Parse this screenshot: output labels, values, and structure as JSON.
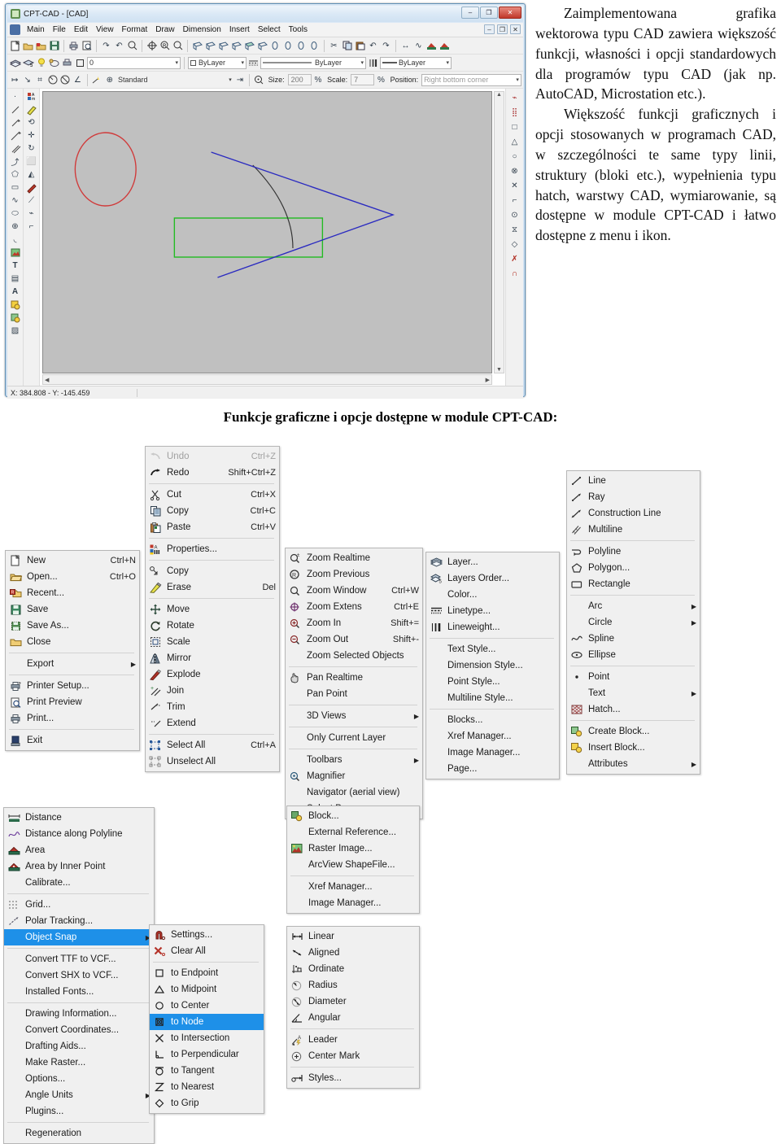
{
  "window": {
    "title": "CPT-CAD - [CAD]",
    "win_buttons": [
      "–",
      "❐",
      "✕"
    ],
    "mdi_buttons": [
      "–",
      "❐",
      "✕"
    ],
    "menus": [
      "Main",
      "File",
      "Edit",
      "View",
      "Format",
      "Draw",
      "Dimension",
      "Insert",
      "Select",
      "Tools"
    ],
    "layer_value": "0",
    "color_value": "ByLayer",
    "linetype_value": "ByLayer",
    "lineweight_value": "ByLayer",
    "text_style_value": "Standard",
    "size_label": "Size:",
    "size_value": "200",
    "scale_label": "Scale:",
    "scale_value": "7",
    "position_label": "Position:",
    "position_value": "Right bottom corner",
    "status_coords": "X: 384.808  -  Y: -145.459"
  },
  "article": {
    "p1": "Zaimplementowana grafika wektorowa typu CAD zawiera większość funkcji, własności i opcji standardowych dla programów typu CAD (jak np. AutoCAD, Microstation etc.).",
    "p2": "Większość funkcji graficznych i opcji stosowanych w programach CAD, w szczególności  te same typy linii, struktury (bloki etc.), wypełnienia typu hatch, warstwy CAD, wymiarowanie, są dostępne w module CPT-CAD i łatwo dostępne z menu i ikon."
  },
  "caption": "Funkcje graficzne i opcje dostępne w module CPT-CAD:",
  "menus": {
    "file": {
      "name": "File",
      "items": [
        {
          "icon": "new-file-icon",
          "label": "New",
          "accel": "Ctrl+N"
        },
        {
          "icon": "open-folder-icon",
          "label": "Open...",
          "accel": "Ctrl+O"
        },
        {
          "icon": "recent-folder-icon",
          "label": "Recent...",
          "accel": ""
        },
        {
          "icon": "save-disk-icon",
          "label": "Save",
          "accel": ""
        },
        {
          "icon": "save-as-disk-icon",
          "label": "Save As...",
          "accel": ""
        },
        {
          "icon": "close-folder-icon",
          "label": "Close",
          "accel": ""
        },
        {
          "sep": true
        },
        {
          "icon": "",
          "label": "Export",
          "accel": "",
          "arrow": true
        },
        {
          "sep": true
        },
        {
          "icon": "printer-setup-icon",
          "label": "Printer Setup...",
          "accel": ""
        },
        {
          "icon": "print-preview-icon",
          "label": "Print Preview",
          "accel": ""
        },
        {
          "icon": "printer-icon",
          "label": "Print...",
          "accel": ""
        },
        {
          "sep": true
        },
        {
          "icon": "exit-icon",
          "label": "Exit",
          "accel": ""
        }
      ]
    },
    "edit": {
      "name": "Edit",
      "items": [
        {
          "icon": "undo-icon",
          "label": "Undo",
          "accel": "Ctrl+Z",
          "disabled": true
        },
        {
          "icon": "redo-icon",
          "label": "Redo",
          "accel": "Shift+Ctrl+Z"
        },
        {
          "sep": true
        },
        {
          "icon": "scissors-icon",
          "label": "Cut",
          "accel": "Ctrl+X"
        },
        {
          "icon": "copy-icon",
          "label": "Copy",
          "accel": "Ctrl+C"
        },
        {
          "icon": "paste-icon",
          "label": "Paste",
          "accel": "Ctrl+V"
        },
        {
          "sep": true
        },
        {
          "icon": "properties-icon",
          "label": "Properties...",
          "accel": ""
        },
        {
          "sep": true
        },
        {
          "icon": "copy-object-icon",
          "label": "Copy",
          "accel": ""
        },
        {
          "icon": "erase-icon",
          "label": "Erase",
          "accel": "Del"
        },
        {
          "sep": true
        },
        {
          "icon": "move-icon",
          "label": "Move",
          "accel": ""
        },
        {
          "icon": "rotate-icon",
          "label": "Rotate",
          "accel": ""
        },
        {
          "icon": "scale-icon",
          "label": "Scale",
          "accel": ""
        },
        {
          "icon": "mirror-icon",
          "label": "Mirror",
          "accel": ""
        },
        {
          "icon": "explode-icon",
          "label": "Explode",
          "accel": ""
        },
        {
          "icon": "join-icon",
          "label": "Join",
          "accel": ""
        },
        {
          "icon": "trim-icon",
          "label": "Trim",
          "accel": ""
        },
        {
          "icon": "extend-icon",
          "label": "Extend",
          "accel": ""
        },
        {
          "sep": true
        },
        {
          "icon": "select-all-icon",
          "label": "Select All",
          "accel": "Ctrl+A"
        },
        {
          "icon": "unselect-all-icon",
          "label": "Unselect All",
          "accel": ""
        }
      ]
    },
    "view": {
      "name": "View",
      "items": [
        {
          "icon": "zoom-realtime-icon",
          "label": "Zoom Realtime",
          "accel": ""
        },
        {
          "icon": "zoom-previous-icon",
          "label": "Zoom Previous",
          "accel": ""
        },
        {
          "icon": "zoom-window-icon",
          "label": "Zoom Window",
          "accel": "Ctrl+W"
        },
        {
          "icon": "zoom-extents-icon",
          "label": "Zoom Extens",
          "accel": "Ctrl+E"
        },
        {
          "icon": "zoom-in-icon",
          "label": "Zoom In",
          "accel": "Shift+="
        },
        {
          "icon": "zoom-out-icon",
          "label": "Zoom Out",
          "accel": "Shift+-"
        },
        {
          "icon": "",
          "label": "Zoom Selected Objects",
          "accel": ""
        },
        {
          "sep": true
        },
        {
          "icon": "pan-realtime-icon",
          "label": "Pan Realtime",
          "accel": ""
        },
        {
          "icon": "",
          "label": "Pan Point",
          "accel": ""
        },
        {
          "sep": true
        },
        {
          "icon": "",
          "label": "3D Views",
          "accel": "",
          "arrow": true
        },
        {
          "sep": true
        },
        {
          "icon": "",
          "label": "Only Current Layer",
          "accel": ""
        },
        {
          "sep": true
        },
        {
          "icon": "",
          "label": "Toolbars",
          "accel": "",
          "arrow": true
        },
        {
          "icon": "magnifier-icon",
          "label": "Magnifier",
          "accel": ""
        },
        {
          "icon": "",
          "label": "Navigator (aerial view)",
          "accel": ""
        },
        {
          "icon": "",
          "label": "Select Page...",
          "accel": ""
        }
      ]
    },
    "format": {
      "name": "Format",
      "items": [
        {
          "icon": "layer-icon",
          "label": "Layer...",
          "accel": ""
        },
        {
          "icon": "layers-order-icon",
          "label": "Layers Order...",
          "accel": ""
        },
        {
          "icon": "",
          "label": "Color...",
          "accel": ""
        },
        {
          "icon": "linetype-icon",
          "label": "Linetype...",
          "accel": ""
        },
        {
          "icon": "lineweight-icon",
          "label": "Lineweight...",
          "accel": ""
        },
        {
          "sep": true
        },
        {
          "icon": "",
          "label": "Text Style...",
          "accel": ""
        },
        {
          "icon": "",
          "label": "Dimension Style...",
          "accel": ""
        },
        {
          "icon": "",
          "label": "Point Style...",
          "accel": ""
        },
        {
          "icon": "",
          "label": "Multiline Style...",
          "accel": ""
        },
        {
          "sep": true
        },
        {
          "icon": "",
          "label": "Blocks...",
          "accel": ""
        },
        {
          "icon": "",
          "label": "Xref Manager...",
          "accel": ""
        },
        {
          "icon": "",
          "label": "Image Manager...",
          "accel": ""
        },
        {
          "icon": "",
          "label": "Page...",
          "accel": ""
        }
      ]
    },
    "draw": {
      "name": "Draw",
      "items": [
        {
          "icon": "line-icon",
          "label": "Line",
          "accel": ""
        },
        {
          "icon": "ray-icon",
          "label": "Ray",
          "accel": ""
        },
        {
          "icon": "construction-line-icon",
          "label": "Construction Line",
          "accel": ""
        },
        {
          "icon": "multiline-icon",
          "label": "Multiline",
          "accel": ""
        },
        {
          "sep": true
        },
        {
          "icon": "polyline-icon",
          "label": "Polyline",
          "accel": ""
        },
        {
          "icon": "polygon-icon",
          "label": "Polygon...",
          "accel": ""
        },
        {
          "icon": "rectangle-icon",
          "label": "Rectangle",
          "accel": ""
        },
        {
          "sep": true
        },
        {
          "icon": "",
          "label": "Arc",
          "accel": "",
          "arrow": true
        },
        {
          "icon": "",
          "label": "Circle",
          "accel": "",
          "arrow": true
        },
        {
          "icon": "spline-icon",
          "label": "Spline",
          "accel": ""
        },
        {
          "icon": "ellipse-icon",
          "label": "Ellipse",
          "accel": ""
        },
        {
          "sep": true
        },
        {
          "icon": "point-icon",
          "label": "Point",
          "accel": ""
        },
        {
          "icon": "",
          "label": "Text",
          "accel": "",
          "arrow": true
        },
        {
          "icon": "hatch-icon",
          "label": "Hatch...",
          "accel": ""
        },
        {
          "sep": true
        },
        {
          "icon": "create-block-icon",
          "label": "Create Block...",
          "accel": ""
        },
        {
          "icon": "insert-block-icon",
          "label": "Insert Block...",
          "accel": ""
        },
        {
          "icon": "",
          "label": "Attributes",
          "accel": "",
          "arrow": true
        }
      ]
    },
    "tools": {
      "name": "Tools",
      "items": [
        {
          "icon": "distance-icon",
          "label": "Distance",
          "accel": ""
        },
        {
          "icon": "distance-polyline-icon",
          "label": "Distance along Polyline",
          "accel": ""
        },
        {
          "icon": "area-icon",
          "label": "Area",
          "accel": ""
        },
        {
          "icon": "area-inner-point-icon",
          "label": "Area by Inner Point",
          "accel": ""
        },
        {
          "icon": "",
          "label": "Calibrate...",
          "accel": ""
        },
        {
          "sep": true
        },
        {
          "icon": "grid-icon",
          "label": "Grid...",
          "accel": ""
        },
        {
          "icon": "polar-tracking-icon",
          "label": "Polar Tracking...",
          "accel": ""
        },
        {
          "icon": "",
          "label": "Object Snap",
          "accel": "",
          "arrow": true,
          "highlight": true
        },
        {
          "sep": true
        },
        {
          "icon": "",
          "label": "Convert TTF to VCF...",
          "accel": ""
        },
        {
          "icon": "",
          "label": "Convert SHX to VCF...",
          "accel": ""
        },
        {
          "icon": "",
          "label": "Installed Fonts...",
          "accel": ""
        },
        {
          "sep": true
        },
        {
          "icon": "",
          "label": "Drawing Information...",
          "accel": ""
        },
        {
          "icon": "",
          "label": "Convert Coordinates...",
          "accel": ""
        },
        {
          "icon": "",
          "label": "Drafting Aids...",
          "accel": ""
        },
        {
          "icon": "",
          "label": "Make Raster...",
          "accel": ""
        },
        {
          "icon": "",
          "label": "Options...",
          "accel": ""
        },
        {
          "icon": "",
          "label": "Angle Units",
          "accel": "",
          "arrow": true
        },
        {
          "icon": "",
          "label": "Plugins...",
          "accel": ""
        },
        {
          "sep": true
        },
        {
          "icon": "",
          "label": "Regeneration",
          "accel": ""
        }
      ]
    },
    "objectsnap": {
      "name": "Object Snap",
      "items": [
        {
          "icon": "snap-settings-icon",
          "label": "Settings...",
          "accel": ""
        },
        {
          "icon": "clear-all-icon",
          "label": "Clear All",
          "accel": ""
        },
        {
          "sep": true
        },
        {
          "icon": "endpoint-icon",
          "label": "to Endpoint",
          "accel": ""
        },
        {
          "icon": "midpoint-icon",
          "label": "to Midpoint",
          "accel": ""
        },
        {
          "icon": "center-icon",
          "label": "to Center",
          "accel": ""
        },
        {
          "icon": "node-icon",
          "label": "to Node",
          "accel": "",
          "highlight": true
        },
        {
          "icon": "intersection-icon",
          "label": "to Intersection",
          "accel": ""
        },
        {
          "icon": "perpendicular-icon",
          "label": "to Perpendicular",
          "accel": ""
        },
        {
          "icon": "tangent-icon",
          "label": "to Tangent",
          "accel": ""
        },
        {
          "icon": "nearest-icon",
          "label": "to Nearest",
          "accel": ""
        },
        {
          "icon": "grip-icon",
          "label": "to Grip",
          "accel": ""
        }
      ]
    },
    "insert": {
      "name": "Insert",
      "items": [
        {
          "icon": "block-icon",
          "label": "Block...",
          "accel": ""
        },
        {
          "icon": "",
          "label": "External Reference...",
          "accel": ""
        },
        {
          "icon": "raster-image-icon",
          "label": "Raster Image...",
          "accel": ""
        },
        {
          "icon": "",
          "label": "ArcView ShapeFile...",
          "accel": ""
        },
        {
          "sep": true
        },
        {
          "icon": "",
          "label": "Xref Manager...",
          "accel": ""
        },
        {
          "icon": "",
          "label": "Image Manager...",
          "accel": ""
        }
      ]
    },
    "dimension": {
      "name": "Dimension",
      "items": [
        {
          "icon": "linear-dim-icon",
          "label": "Linear",
          "accel": ""
        },
        {
          "icon": "aligned-dim-icon",
          "label": "Aligned",
          "accel": ""
        },
        {
          "icon": "ordinate-dim-icon",
          "label": "Ordinate",
          "accel": ""
        },
        {
          "icon": "radius-dim-icon",
          "label": "Radius",
          "accel": ""
        },
        {
          "icon": "diameter-dim-icon",
          "label": "Diameter",
          "accel": ""
        },
        {
          "icon": "angular-dim-icon",
          "label": "Angular",
          "accel": ""
        },
        {
          "sep": true
        },
        {
          "icon": "leader-icon",
          "label": "Leader",
          "accel": ""
        },
        {
          "icon": "center-mark-icon",
          "label": "Center Mark",
          "accel": ""
        },
        {
          "sep": true
        },
        {
          "icon": "dim-styles-icon",
          "label": "Styles...",
          "accel": ""
        }
      ]
    }
  }
}
